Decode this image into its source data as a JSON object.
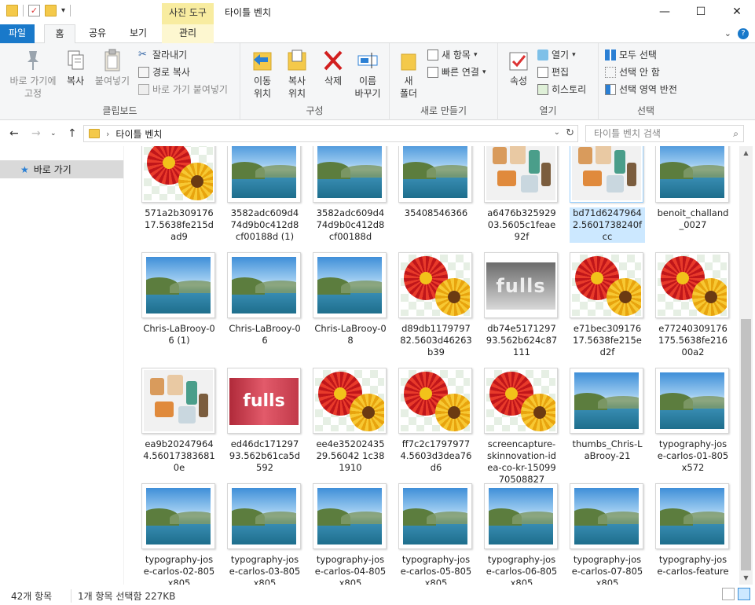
{
  "window": {
    "title": "타이틀 벤치",
    "context_tools": "사진 도구"
  },
  "tabs": {
    "file": "파일",
    "home": "홈",
    "share": "공유",
    "view": "보기",
    "manage": "관리"
  },
  "ribbon": {
    "clipboard": {
      "label": "클립보드",
      "pin": "바로 가기에\n고정",
      "copy": "복사",
      "paste": "붙여넣기",
      "cut": "잘라내기",
      "copy_path": "경로 복사",
      "paste_shortcut": "바로 가기 붙여넣기"
    },
    "organize": {
      "label": "구성",
      "move_to": "이동\n위치",
      "copy_to": "복사\n위치",
      "delete": "삭제",
      "rename": "이름\n바꾸기"
    },
    "new": {
      "label": "새로 만들기",
      "new_folder": "새\n폴더",
      "new_item": "새 항목",
      "easy_access": "빠른 연결"
    },
    "open": {
      "label": "열기",
      "properties": "속성",
      "open": "열기",
      "edit": "편집",
      "history": "히스토리"
    },
    "select": {
      "label": "선택",
      "select_all": "모두 선택",
      "select_none": "선택 안 함",
      "invert": "선택 영역 반전"
    }
  },
  "address": {
    "path": "타이틀 벤치",
    "search_placeholder": "타이틀 벤치 검색"
  },
  "navpane": {
    "quick_access": "바로 가기"
  },
  "files": [
    {
      "name": "571a2b30917617.5638fe215dad9",
      "thumb": "flower"
    },
    {
      "name": "3582adc609d474d9b0c412d8cf00188d (1)",
      "thumb": "landscape"
    },
    {
      "name": "3582adc609d474d9b0c412d8cf00188d",
      "thumb": "landscape"
    },
    {
      "name": "35408546366",
      "thumb": "landscape"
    },
    {
      "name": "a6476b32592903.5605c1feae92f",
      "thumb": "letters"
    },
    {
      "name": "bd71d62479642.5601738240fcc",
      "thumb": "letters",
      "selected": true
    },
    {
      "name": "benoit_challand_0027",
      "thumb": "landscape"
    },
    {
      "name": "Chris-LaBrooy-06 (1)",
      "thumb": "landscape"
    },
    {
      "name": "Chris-LaBrooy-06",
      "thumb": "landscape"
    },
    {
      "name": "Chris-LaBrooy-08",
      "thumb": "landscape"
    },
    {
      "name": "d89db117979782.5603d46263b39",
      "thumb": "flower"
    },
    {
      "name": "db74e517129793.562b624c87111",
      "thumb": "fulls",
      "thumb_text": "fulls"
    },
    {
      "name": "e71bec30917617.5638fe215ed2f",
      "thumb": "flower"
    },
    {
      "name": "e77240309176175.5638fe21600a2",
      "thumb": "flower"
    },
    {
      "name": "ea9b202479644.560173836810e",
      "thumb": "letters"
    },
    {
      "name": "ed46dc17129793.562b61ca5d592",
      "thumb": "fulls-red",
      "thumb_text": "fulls"
    },
    {
      "name": "ee4e3520243529.56042 1c381910",
      "thumb": "flower"
    },
    {
      "name": "ff7c2c17979774.5603d3dea76d6",
      "thumb": "flower"
    },
    {
      "name": "screencapture-skinnovation-idea-co-kr-1509970508827",
      "thumb": "flower"
    },
    {
      "name": "thumbs_Chris-LaBrooy-21",
      "thumb": "landscape"
    },
    {
      "name": "typography-jose-carlos-01-805x572",
      "thumb": "landscape"
    },
    {
      "name": "typography-jose-carlos-02-805x805",
      "thumb": "landscape"
    },
    {
      "name": "typography-jose-carlos-03-805x805",
      "thumb": "landscape"
    },
    {
      "name": "typography-jose-carlos-04-805x805",
      "thumb": "landscape"
    },
    {
      "name": "typography-jose-carlos-05-805x805",
      "thumb": "landscape"
    },
    {
      "name": "typography-jose-carlos-06-805x805",
      "thumb": "landscape"
    },
    {
      "name": "typography-jose-carlos-07-805x805",
      "thumb": "landscape"
    },
    {
      "name": "typography-jose-carlos-feature",
      "thumb": "landscape"
    }
  ],
  "status": {
    "count": "42개 항목",
    "selection": "1개 항목 선택함 227KB"
  },
  "colors": {
    "file_tab": "#1979ca",
    "context_tools": "#f8eca0",
    "selection": "#cce8ff"
  }
}
